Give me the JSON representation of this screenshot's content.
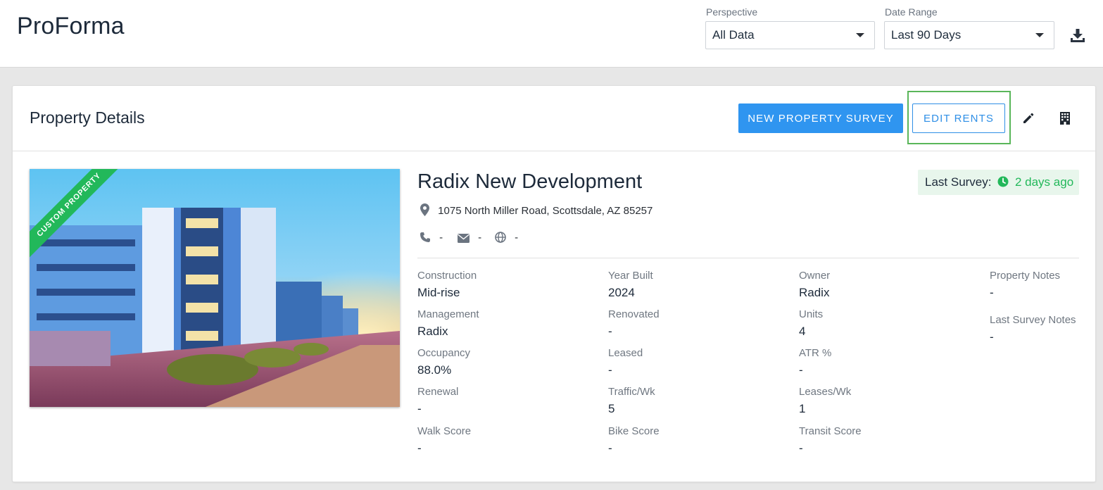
{
  "header": {
    "app_title": "ProForma",
    "perspective": {
      "label": "Perspective",
      "value": "All Data"
    },
    "date_range": {
      "label": "Date Range",
      "value": "Last 90 Days"
    },
    "download_icon": "download-icon"
  },
  "card": {
    "title": "Property Details",
    "new_survey_label": "NEW PROPERTY SURVEY",
    "edit_rents_label": "EDIT RENTS",
    "edit_icon": "pencil-icon",
    "building_icon": "building-icon"
  },
  "property": {
    "ribbon": "CUSTOM PROPERTY",
    "name": "Radix New Development",
    "last_survey_label": "Last Survey:",
    "last_survey_value": "2 days ago",
    "address": "1075 North Miller Road, Scottsdale, AZ 85257",
    "phone": "-",
    "email": "-",
    "website": "-",
    "fields": {
      "construction": {
        "label": "Construction",
        "value": "Mid-rise"
      },
      "year_built": {
        "label": "Year Built",
        "value": "2024"
      },
      "owner": {
        "label": "Owner",
        "value": "Radix"
      },
      "property_notes": {
        "label": "Property Notes",
        "value": "-"
      },
      "management": {
        "label": "Management",
        "value": "Radix"
      },
      "renovated": {
        "label": "Renovated",
        "value": "-"
      },
      "units": {
        "label": "Units",
        "value": "4"
      },
      "last_survey_notes": {
        "label": "Last Survey Notes",
        "value": "-"
      },
      "occupancy": {
        "label": "Occupancy",
        "value": "88.0%"
      },
      "leased": {
        "label": "Leased",
        "value": "-"
      },
      "atr": {
        "label": "ATR %",
        "value": "-"
      },
      "renewal": {
        "label": "Renewal",
        "value": "-"
      },
      "traffic": {
        "label": "Traffic/Wk",
        "value": "5"
      },
      "leases": {
        "label": "Leases/Wk",
        "value": "1"
      },
      "walk_score": {
        "label": "Walk Score",
        "value": "-"
      },
      "bike_score": {
        "label": "Bike Score",
        "value": "-"
      },
      "transit_score": {
        "label": "Transit Score",
        "value": "-"
      }
    }
  },
  "colors": {
    "primary": "#2f95f0",
    "success": "#22b85a",
    "highlight": "#5ab65a",
    "text": "#1d2a3a"
  }
}
